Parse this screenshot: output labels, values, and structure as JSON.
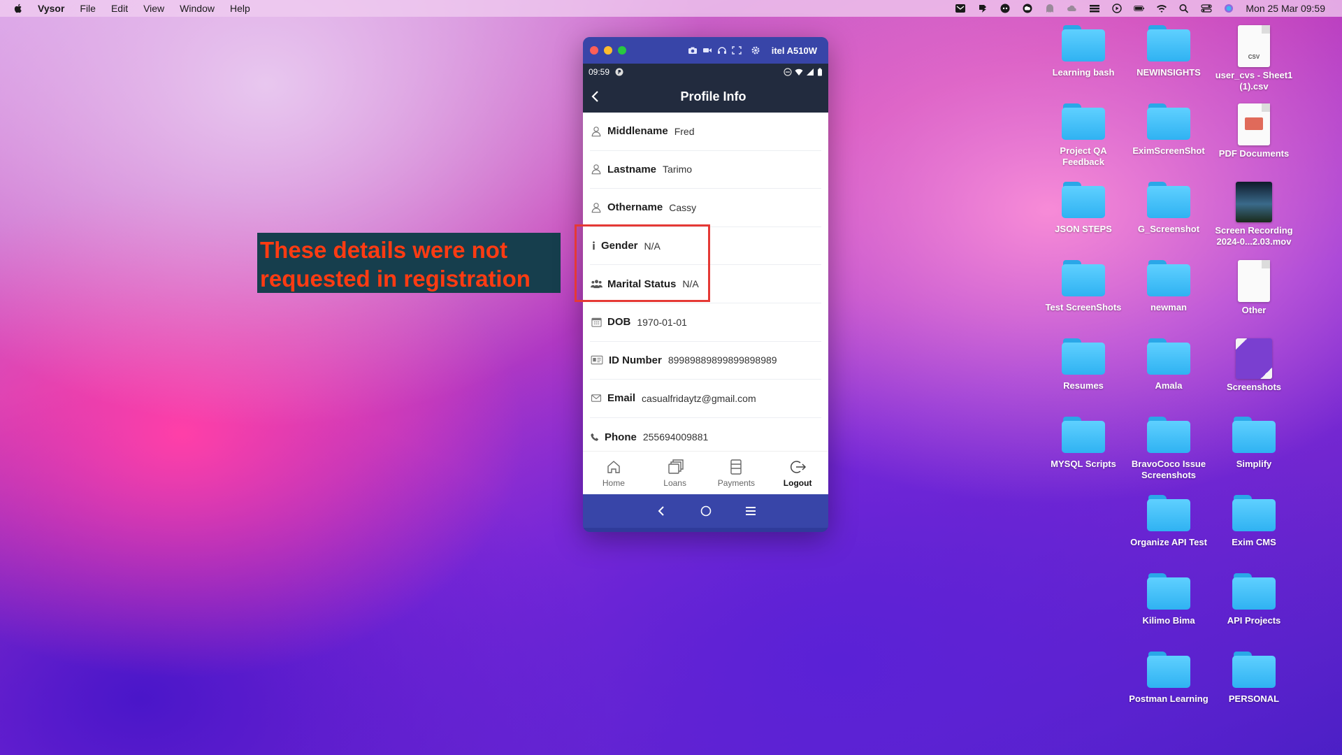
{
  "menubar": {
    "app_name": "Vysor",
    "menus": [
      "File",
      "Edit",
      "View",
      "Window",
      "Help"
    ],
    "datetime": "Mon 25 Mar  09:59"
  },
  "device": {
    "window_name": "itel A510W",
    "status_time": "09:59",
    "screen_title": "Profile Info",
    "fields": [
      {
        "icon": "user-icon",
        "label": "Middlename",
        "value": "Fred"
      },
      {
        "icon": "user-icon",
        "label": "Lastname",
        "value": "Tarimo"
      },
      {
        "icon": "user-icon",
        "label": "Othername",
        "value": "Cassy"
      },
      {
        "icon": "info-icon",
        "label": "Gender",
        "value": "N/A"
      },
      {
        "icon": "group-icon",
        "label": "Marital Status",
        "value": "N/A"
      },
      {
        "icon": "calendar-icon",
        "label": "DOB",
        "value": "1970-01-01"
      },
      {
        "icon": "id-card-icon",
        "label": "ID Number",
        "value": "89989889899899898989"
      },
      {
        "icon": "mail-icon",
        "label": "Email",
        "value": "casualfridaytz@gmail.com"
      },
      {
        "icon": "phone-icon",
        "label": "Phone",
        "value": "255694009881"
      }
    ],
    "bottom_nav": [
      "Home",
      "Loans",
      "Payments",
      "Logout"
    ]
  },
  "annotation": {
    "note": "These details were not requested in registration",
    "color": "#ff3b12",
    "box_color": "#e53935"
  },
  "desktop_icons": [
    {
      "label": "Learning bash",
      "type": "folder"
    },
    {
      "label": "NEWINSIGHTS",
      "type": "folder"
    },
    {
      "label": "user_cvs - Sheet1 (1).csv",
      "type": "csv"
    },
    {
      "label": "Project QA Feedback",
      "type": "folder"
    },
    {
      "label": "EximScreenShot",
      "type": "folder"
    },
    {
      "label": "PDF Documents",
      "type": "pdf"
    },
    {
      "label": "JSON STEPS",
      "type": "folder"
    },
    {
      "label": "G_Screenshot",
      "type": "folder"
    },
    {
      "label": "Screen Recording 2024-0...2.03.mov",
      "type": "video"
    },
    {
      "label": "Test ScreenShots",
      "type": "folder"
    },
    {
      "label": "newman",
      "type": "folder"
    },
    {
      "label": "Other",
      "type": "doc"
    },
    {
      "label": "Resumes",
      "type": "folder"
    },
    {
      "label": "Amala",
      "type": "folder"
    },
    {
      "label": "Screenshots",
      "type": "image"
    },
    {
      "label": "MYSQL Scripts",
      "type": "folder"
    },
    {
      "label": "BravoCoco Issue Screenshots",
      "type": "folder"
    },
    {
      "label": "Simplify",
      "type": "folder"
    },
    {
      "label": "Organize API Test",
      "type": "folder"
    },
    {
      "label": "Exim CMS",
      "type": "folder"
    },
    {
      "label": "Kilimo Bima",
      "type": "folder"
    },
    {
      "label": "API Projects",
      "type": "folder"
    },
    {
      "label": "Postman Learning",
      "type": "folder"
    },
    {
      "label": "PERSONAL",
      "type": "folder"
    }
  ]
}
